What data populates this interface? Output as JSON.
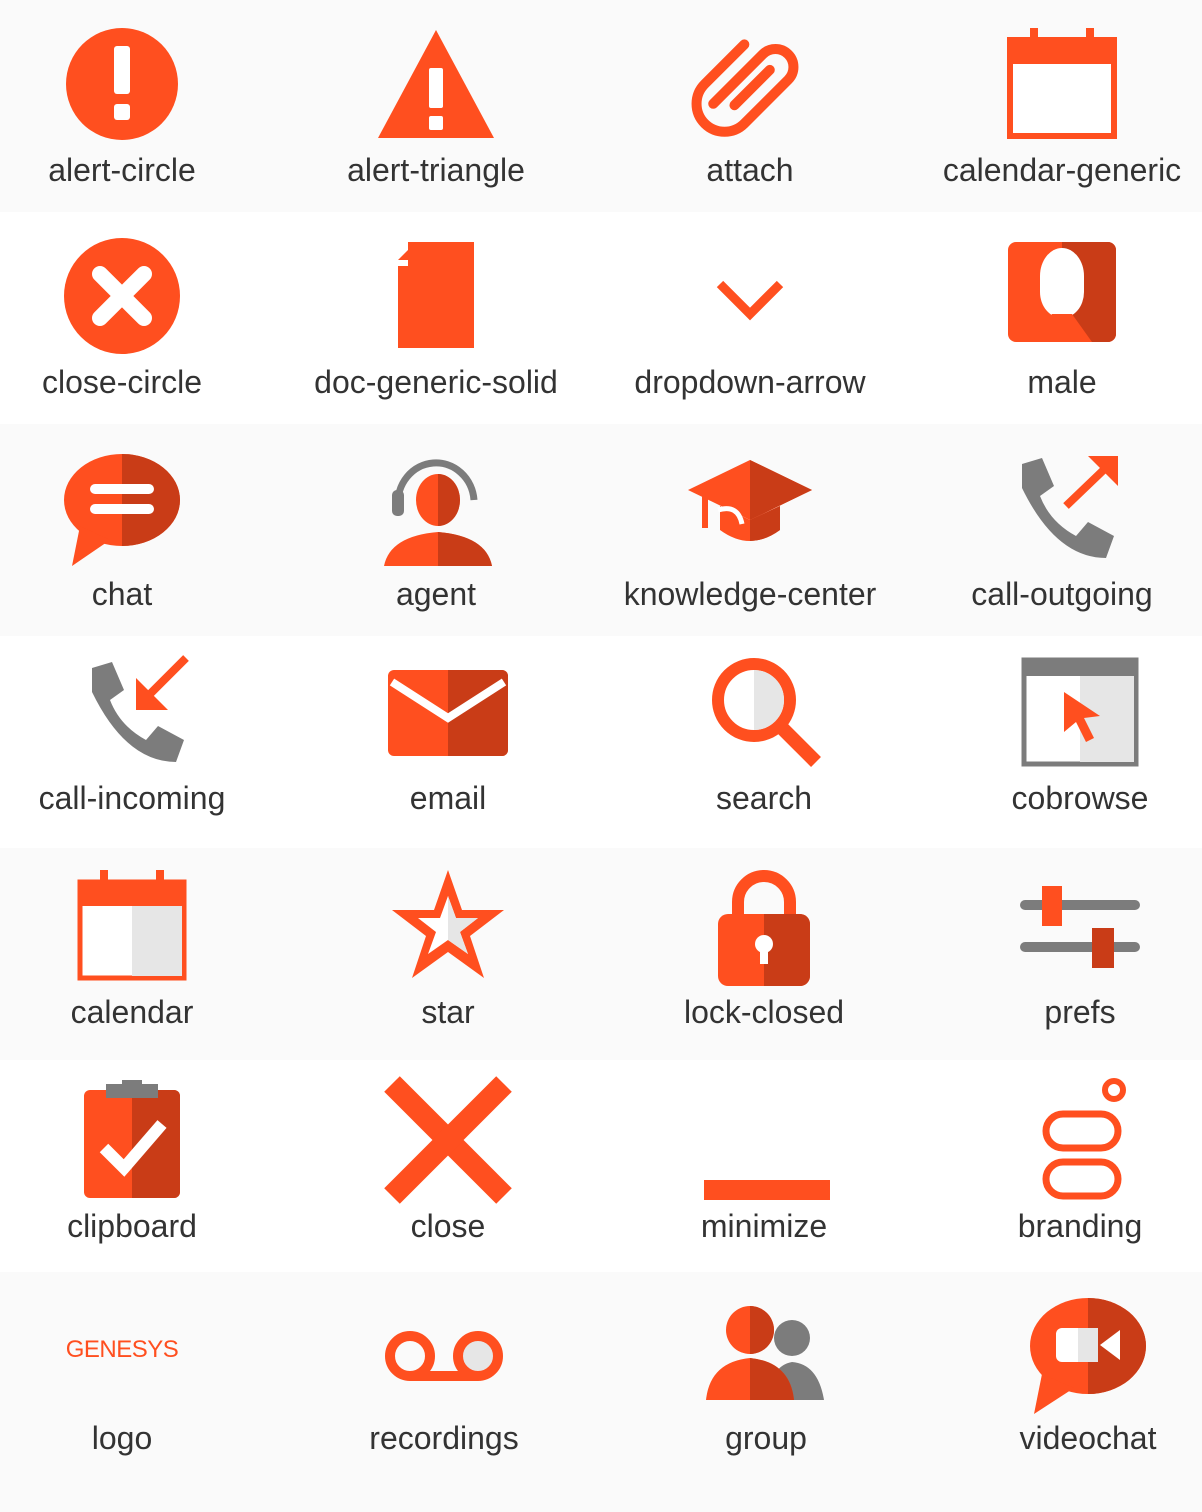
{
  "colors": {
    "accent": "#ff4f1f",
    "accent_dark": "#c93c17",
    "gray": "#7c7c7c",
    "light": "#e6e6e6"
  },
  "rows": [
    [
      "alert-circle",
      "alert-triangle",
      "attach",
      "calendar-generic"
    ],
    [
      "close-circle",
      "doc-generic-solid",
      "dropdown-arrow",
      "male"
    ],
    [
      "chat",
      "agent",
      "knowledge-center",
      "call-outgoing"
    ],
    [
      "call-incoming",
      "email",
      "search",
      "cobrowse"
    ],
    [
      "calendar",
      "star",
      "lock-closed",
      "prefs"
    ],
    [
      "clipboard",
      "close",
      "minimize",
      "branding"
    ],
    [
      "logo",
      "recordings",
      "group",
      "videochat"
    ]
  ],
  "logo_text": "GENESYS"
}
